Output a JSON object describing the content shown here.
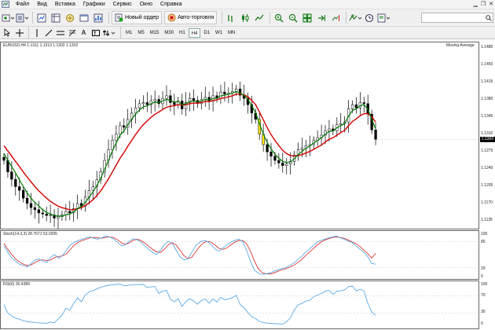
{
  "menu": {
    "items": [
      "Файл",
      "Вид",
      "Вставка",
      "Графики",
      "Сервис",
      "Окно",
      "Справка"
    ]
  },
  "toolbar": {
    "new_order_label": "Новый ордер",
    "autotrading_label": "Авто-торговля",
    "search_placeholder": ""
  },
  "timeframes": {
    "items": [
      "M1",
      "M5",
      "M15",
      "M30",
      "H1",
      "H4",
      "D1",
      "W1",
      "MN"
    ],
    "active": "H4"
  },
  "main_chart": {
    "header": "EURUSD,H4  1.1311 1.1313 1.1302 1.1302",
    "indicator_name": "Moving Average",
    "price_ticks": [
      "1.1485",
      "1.1450",
      "1.1415",
      "1.1380",
      "1.1345",
      "1.1310",
      "1.1275",
      "1.1240",
      "1.1205",
      "1.1170",
      "1.1135"
    ],
    "current_price": "1.1302"
  },
  "stoch": {
    "header": "Stoch(14,3,3) 28.7671 53.0205",
    "ticks": [
      "100",
      "80",
      "20",
      "0"
    ]
  },
  "rsi": {
    "header": "RSI(6) 30.4389",
    "ticks": [
      "100",
      "70",
      "30",
      "0"
    ]
  },
  "colors": {
    "bull_candle": "#000000",
    "bear_candle": "#000000",
    "ma_fast": "#007a00",
    "ma_slow": "#d40000",
    "highlight": "#ffe800",
    "osc_main": "#5aa9e6",
    "osc_signal": "#d40000",
    "price_tag_bg": "#000000"
  },
  "chart_data": {
    "type": "candlestick",
    "symbol": "EURUSD",
    "timeframe": "H4",
    "y_range": [
      1.1135,
      1.1485
    ],
    "closes": [
      1.1262,
      1.124,
      1.1226,
      1.1212,
      1.1205,
      1.119,
      1.118,
      1.1172,
      1.1168,
      1.1162,
      1.116,
      1.1157,
      1.1158,
      1.1152,
      1.1155,
      1.1158,
      1.1165,
      1.1162,
      1.117,
      1.118,
      1.1175,
      1.1192,
      1.1205,
      1.1212,
      1.1225,
      1.124,
      1.1262,
      1.1282,
      1.13,
      1.1312,
      1.1328,
      1.1325,
      1.134,
      1.1352,
      1.1362,
      1.137,
      1.1372,
      1.1368,
      1.1375,
      1.1378,
      1.137,
      1.138,
      1.1385,
      1.1372,
      1.1368,
      1.1375,
      1.136,
      1.1372,
      1.138,
      1.1376,
      1.137,
      1.1378,
      1.1382,
      1.1375,
      1.1385,
      1.138,
      1.1392,
      1.1388,
      1.139,
      1.1393,
      1.1398,
      1.1386,
      1.138,
      1.1368,
      1.1352,
      1.134,
      1.1312,
      1.1292,
      1.1278,
      1.127,
      1.1262,
      1.1257,
      1.1252,
      1.1255,
      1.126,
      1.1272,
      1.1282,
      1.1285,
      1.129,
      1.1292,
      1.13,
      1.1305,
      1.131,
      1.1318,
      1.1322,
      1.1318,
      1.133,
      1.1332,
      1.1335,
      1.136,
      1.1368,
      1.1362,
      1.1372,
      1.137,
      1.135,
      1.132,
      1.1302
    ],
    "ma_fast": [
      1.1275,
      1.1262,
      1.125,
      1.1238,
      1.1225,
      1.1212,
      1.12,
      1.119,
      1.1182,
      1.1175,
      1.1168,
      1.1163,
      1.116,
      1.1157,
      1.1156,
      1.1156,
      1.1158,
      1.116,
      1.1164,
      1.117,
      1.1174,
      1.1182,
      1.1192,
      1.1202,
      1.1214,
      1.1228,
      1.1245,
      1.1262,
      1.128,
      1.1295,
      1.131,
      1.1318,
      1.133,
      1.134,
      1.135,
      1.1358,
      1.1364,
      1.1366,
      1.137,
      1.1373,
      1.1372,
      1.1375,
      1.1378,
      1.1376,
      1.1373,
      1.1374,
      1.1368,
      1.137,
      1.1374,
      1.1375,
      1.1373,
      1.1375,
      1.1378,
      1.1377,
      1.138,
      1.138,
      1.1385,
      1.1386,
      1.1388,
      1.139,
      1.1393,
      1.139,
      1.1386,
      1.1378,
      1.1366,
      1.1353,
      1.1332,
      1.1312,
      1.1296,
      1.1284,
      1.1274,
      1.1266,
      1.126,
      1.1258,
      1.1259,
      1.1265,
      1.1273,
      1.1279,
      1.1285,
      1.1289,
      1.1295,
      1.13,
      1.1305,
      1.1312,
      1.1317,
      1.1318,
      1.1324,
      1.1328,
      1.1332,
      1.1346,
      1.1357,
      1.136,
      1.1366,
      1.1368,
      1.1359,
      1.134,
      1.1322
    ],
    "ma_slow": [
      1.129,
      1.128,
      1.127,
      1.126,
      1.125,
      1.124,
      1.123,
      1.1221,
      1.1212,
      1.1204,
      1.1197,
      1.119,
      1.1184,
      1.1179,
      1.1175,
      1.1172,
      1.117,
      1.1168,
      1.1168,
      1.117,
      1.1172,
      1.1176,
      1.1181,
      1.1187,
      1.1195,
      1.1204,
      1.1215,
      1.1227,
      1.124,
      1.1253,
      1.1266,
      1.1277,
      1.1289,
      1.13,
      1.1311,
      1.1321,
      1.133,
      1.1337,
      1.1344,
      1.135,
      1.1354,
      1.1359,
      1.1363,
      1.1365,
      1.1366,
      1.1368,
      1.1367,
      1.1368,
      1.137,
      1.1371,
      1.1371,
      1.1372,
      1.1374,
      1.1374,
      1.1376,
      1.1377,
      1.138,
      1.1381,
      1.1383,
      1.1385,
      1.1388,
      1.1388,
      1.1387,
      1.1383,
      1.1376,
      1.1368,
      1.1354,
      1.1339,
      1.1324,
      1.1311,
      1.13,
      1.129,
      1.1281,
      1.1275,
      1.1271,
      1.127,
      1.1271,
      1.1273,
      1.1276,
      1.1279,
      1.1283,
      1.1287,
      1.1291,
      1.1297,
      1.1302,
      1.1305,
      1.131,
      1.1315,
      1.1319,
      1.1328,
      1.1336,
      1.1341,
      1.1347,
      1.1351,
      1.1351,
      1.1345,
      1.1335
    ],
    "stoch_main": [
      70,
      55,
      42,
      35,
      28,
      25,
      22,
      30,
      38,
      40,
      35,
      32,
      45,
      50,
      42,
      48,
      60,
      72,
      78,
      82,
      85,
      88,
      90,
      87,
      85,
      88,
      92,
      90,
      86,
      78,
      70,
      72,
      80,
      86,
      84,
      78,
      70,
      62,
      55,
      50,
      60,
      72,
      80,
      76,
      60,
      45,
      38,
      40,
      55,
      70,
      78,
      82,
      80,
      72,
      62,
      58,
      65,
      72,
      78,
      82,
      85,
      80,
      60,
      35,
      15,
      8,
      5,
      6,
      8,
      12,
      15,
      18,
      20,
      25,
      30,
      38,
      45,
      55,
      62,
      70,
      78,
      82,
      85,
      88,
      90,
      92,
      88,
      85,
      80,
      78,
      70,
      62,
      55,
      45,
      30,
      28
    ],
    "stoch_signal": [
      75,
      62,
      50,
      40,
      33,
      28,
      25,
      27,
      32,
      37,
      38,
      36,
      38,
      44,
      46,
      47,
      52,
      62,
      72,
      78,
      82,
      85,
      88,
      89,
      88,
      87,
      89,
      90,
      89,
      84,
      77,
      73,
      76,
      82,
      85,
      82,
      76,
      69,
      62,
      56,
      55,
      62,
      72,
      77,
      72,
      60,
      48,
      41,
      44,
      56,
      68,
      77,
      80,
      78,
      71,
      64,
      62,
      65,
      72,
      78,
      82,
      82,
      75,
      58,
      36,
      18,
      9,
      6,
      6,
      8,
      12,
      15,
      18,
      21,
      25,
      31,
      38,
      47,
      55,
      63,
      71,
      78,
      83,
      86,
      89,
      90,
      89,
      87,
      83,
      79,
      75,
      68,
      60,
      52,
      42,
      53
    ]
  }
}
